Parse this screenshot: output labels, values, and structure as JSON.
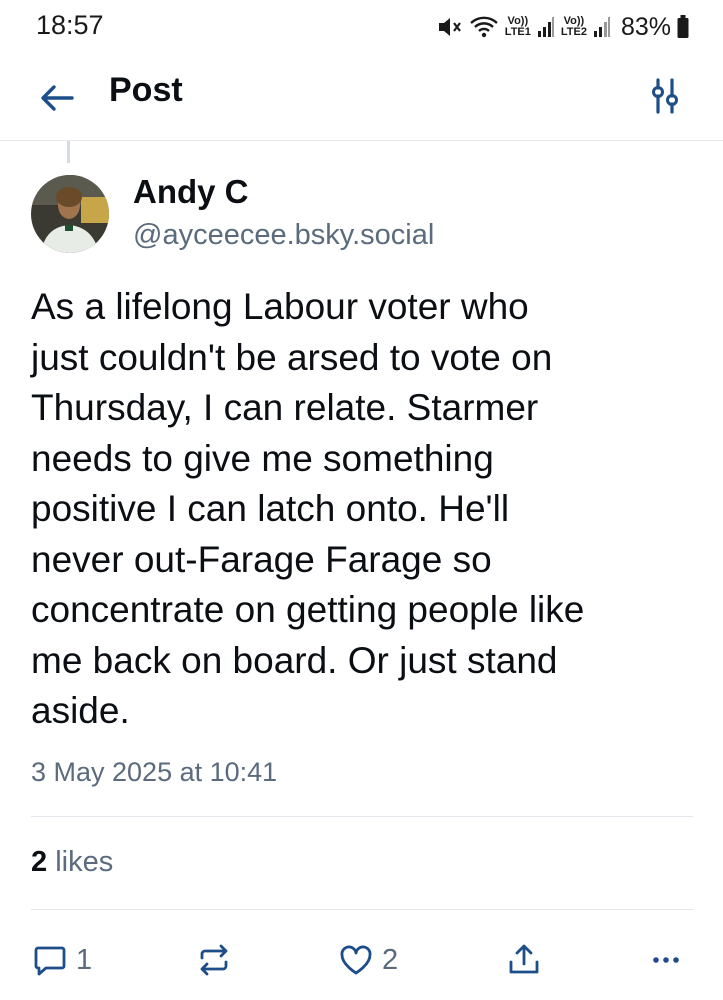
{
  "status_bar": {
    "time": "18:57",
    "sim1_label": "Vo))\nLTE1",
    "sim2_label": "Vo))\nLTE2",
    "battery": "83%"
  },
  "header": {
    "title": "Post",
    "back_icon": "arrow-left-icon",
    "filter_icon": "sliders-icon"
  },
  "post": {
    "author_name": "Andy C",
    "author_handle": "@ayceecee.bsky.social",
    "text": "As a lifelong Labour voter who\njust couldn't be arsed to vote on\nThursday, I can relate.  Starmer\nneeds to give me something\npositive I can latch onto. He'll\nnever out-Farage Farage so\nconcentrate on getting people like\nme back on board. Or just stand\naside.",
    "timestamp": "3 May 2025 at 10:41",
    "likes_count": "2",
    "likes_label": "likes"
  },
  "actions": {
    "reply_count": "1",
    "repost_count": "",
    "like_count": "2"
  },
  "colors": {
    "accent": "#1d4e89",
    "muted_text": "#5b6b7d",
    "divider": "#e3e7ec"
  }
}
